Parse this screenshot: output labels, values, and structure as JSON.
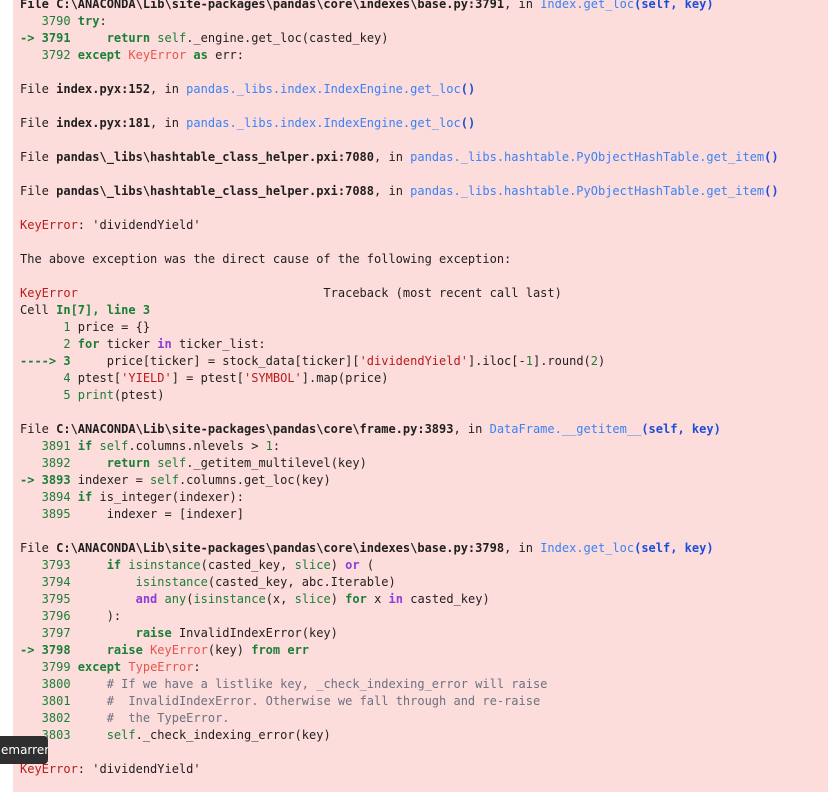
{
  "traceback_lines": [
    [
      [
        "b",
        "File C:\\ANACONDA\\Lib\\site-packages\\pandas\\core\\indexes\\base.py:3791"
      ],
      [
        "n",
        ", in "
      ],
      [
        "link",
        "Index.get_loc"
      ],
      [
        "cyanb",
        "(self, key)"
      ]
    ],
    [
      [
        "ln",
        "   3790 "
      ],
      [
        "kw",
        "try"
      ],
      [
        "n",
        ":"
      ]
    ],
    [
      [
        "lnb",
        "-> 3791 "
      ],
      [
        "n",
        "    "
      ],
      [
        "kw",
        "return"
      ],
      [
        "n",
        " "
      ],
      [
        "g",
        "self"
      ],
      [
        "n",
        "._engine.get_loc(casted_key)"
      ]
    ],
    [
      [
        "ln",
        "   3792 "
      ],
      [
        "kw",
        "except"
      ],
      [
        "n",
        " "
      ],
      [
        "r",
        "KeyError"
      ],
      [
        "n",
        " "
      ],
      [
        "kw",
        "as"
      ],
      [
        "n",
        " err:"
      ]
    ],
    [],
    [
      [
        "n",
        "File "
      ],
      [
        "b",
        "index.pyx:152"
      ],
      [
        "n",
        ", in "
      ],
      [
        "link",
        "pandas._libs.index.IndexEngine.get_loc"
      ],
      [
        "cyanb",
        "()"
      ]
    ],
    [],
    [
      [
        "n",
        "File "
      ],
      [
        "b",
        "index.pyx:181"
      ],
      [
        "n",
        ", in "
      ],
      [
        "link",
        "pandas._libs.index.IndexEngine.get_loc"
      ],
      [
        "cyanb",
        "()"
      ]
    ],
    [],
    [
      [
        "n",
        "File "
      ],
      [
        "b",
        "pandas\\_libs\\hashtable_class_helper.pxi:7080"
      ],
      [
        "n",
        ", in "
      ],
      [
        "link",
        "pandas._libs.hashtable.PyObjectHashTable.get_item"
      ],
      [
        "cyanb",
        "()"
      ]
    ],
    [],
    [
      [
        "n",
        "File "
      ],
      [
        "b",
        "pandas\\_libs\\hashtable_class_helper.pxi:7088"
      ],
      [
        "n",
        ", in "
      ],
      [
        "link",
        "pandas._libs.hashtable.PyObjectHashTable.get_item"
      ],
      [
        "cyanb",
        "()"
      ]
    ],
    [],
    [
      [
        "err",
        "KeyError"
      ],
      [
        "n",
        ": 'dividendYield'"
      ]
    ],
    [],
    [
      [
        "n",
        "The above exception was the direct cause of the following exception:"
      ]
    ],
    [],
    [
      [
        "err",
        "KeyError"
      ],
      [
        "n",
        "                                  Traceback (most recent call last)"
      ]
    ],
    [
      [
        "n",
        "Cell "
      ],
      [
        "gb",
        "In[7], line 3"
      ]
    ],
    [
      [
        "ln",
        "      1 "
      ],
      [
        "n",
        "price "
      ],
      [
        "n",
        "= {}"
      ]
    ],
    [
      [
        "ln",
        "      2 "
      ],
      [
        "kw",
        "for"
      ],
      [
        "n",
        " ticker "
      ],
      [
        "kwp",
        "in"
      ],
      [
        "n",
        " ticker_list:"
      ]
    ],
    [
      [
        "lnb",
        "----> 3 "
      ],
      [
        "n",
        "    price[ticker] "
      ],
      [
        "n",
        "= stock_data[ticker]["
      ],
      [
        "str",
        "'dividendYield'"
      ],
      [
        "n",
        "].iloc["
      ],
      [
        "n",
        "-"
      ],
      [
        "num",
        "1"
      ],
      [
        "n",
        "].round("
      ],
      [
        "num",
        "2"
      ],
      [
        "n",
        ")"
      ]
    ],
    [
      [
        "ln",
        "      4 "
      ],
      [
        "n",
        "ptest["
      ],
      [
        "str",
        "'YIELD'"
      ],
      [
        "n",
        "] = ptest["
      ],
      [
        "str",
        "'SYMBOL'"
      ],
      [
        "n",
        "].map(price)"
      ]
    ],
    [
      [
        "ln",
        "      5 "
      ],
      [
        "g",
        "print"
      ],
      [
        "n",
        "(ptest)"
      ]
    ],
    [],
    [
      [
        "n",
        "File "
      ],
      [
        "b",
        "C:\\ANACONDA\\Lib\\site-packages\\pandas\\core\\frame.py:3893"
      ],
      [
        "n",
        ", in "
      ],
      [
        "link",
        "DataFrame.__getitem__"
      ],
      [
        "cyanb",
        "(self, key)"
      ]
    ],
    [
      [
        "ln",
        "   3891 "
      ],
      [
        "kw",
        "if"
      ],
      [
        "n",
        " "
      ],
      [
        "g",
        "self"
      ],
      [
        "n",
        ".columns.nlevels > "
      ],
      [
        "num",
        "1"
      ],
      [
        "n",
        ":"
      ]
    ],
    [
      [
        "ln",
        "   3892 "
      ],
      [
        "n",
        "    "
      ],
      [
        "kw",
        "return"
      ],
      [
        "n",
        " "
      ],
      [
        "g",
        "self"
      ],
      [
        "n",
        "._getitem_multilevel(key)"
      ]
    ],
    [
      [
        "lnb",
        "-> 3893 "
      ],
      [
        "n",
        "indexer = "
      ],
      [
        "g",
        "self"
      ],
      [
        "n",
        ".columns.get_loc(key)"
      ]
    ],
    [
      [
        "ln",
        "   3894 "
      ],
      [
        "kw",
        "if"
      ],
      [
        "n",
        " is_integer(indexer):"
      ]
    ],
    [
      [
        "ln",
        "   3895 "
      ],
      [
        "n",
        "    indexer = [indexer]"
      ]
    ],
    [],
    [
      [
        "n",
        "File "
      ],
      [
        "b",
        "C:\\ANACONDA\\Lib\\site-packages\\pandas\\core\\indexes\\base.py:3798"
      ],
      [
        "n",
        ", in "
      ],
      [
        "link",
        "Index.get_loc"
      ],
      [
        "cyanb",
        "(self, key)"
      ]
    ],
    [
      [
        "ln",
        "   3793 "
      ],
      [
        "n",
        "    "
      ],
      [
        "kw",
        "if"
      ],
      [
        "n",
        " "
      ],
      [
        "g",
        "isinstance"
      ],
      [
        "n",
        "(casted_key, "
      ],
      [
        "g",
        "slice"
      ],
      [
        "n",
        ") "
      ],
      [
        "kwp",
        "or"
      ],
      [
        "n",
        " ("
      ]
    ],
    [
      [
        "ln",
        "   3794 "
      ],
      [
        "n",
        "        "
      ],
      [
        "g",
        "isinstance"
      ],
      [
        "n",
        "(casted_key, abc.Iterable)"
      ]
    ],
    [
      [
        "ln",
        "   3795 "
      ],
      [
        "n",
        "        "
      ],
      [
        "kwp",
        "and"
      ],
      [
        "n",
        " "
      ],
      [
        "g",
        "any"
      ],
      [
        "n",
        "("
      ],
      [
        "g",
        "isinstance"
      ],
      [
        "n",
        "(x, "
      ],
      [
        "g",
        "slice"
      ],
      [
        "n",
        ") "
      ],
      [
        "kw",
        "for"
      ],
      [
        "n",
        " x "
      ],
      [
        "kwp",
        "in"
      ],
      [
        "n",
        " casted_key)"
      ]
    ],
    [
      [
        "ln",
        "   3796 "
      ],
      [
        "n",
        "    ):"
      ]
    ],
    [
      [
        "ln",
        "   3797 "
      ],
      [
        "n",
        "        "
      ],
      [
        "kw",
        "raise"
      ],
      [
        "n",
        " InvalidIndexError(key)"
      ]
    ],
    [
      [
        "lnb",
        "-> 3798 "
      ],
      [
        "n",
        "    "
      ],
      [
        "kw",
        "raise"
      ],
      [
        "n",
        " "
      ],
      [
        "r",
        "KeyError"
      ],
      [
        "n",
        "(key) "
      ],
      [
        "kw",
        "from"
      ],
      [
        "n",
        " "
      ],
      [
        "kw",
        "err"
      ]
    ],
    [
      [
        "ln",
        "   3799 "
      ],
      [
        "kw",
        "except"
      ],
      [
        "n",
        " "
      ],
      [
        "r",
        "TypeError"
      ],
      [
        "n",
        ":"
      ]
    ],
    [
      [
        "ln",
        "   3800 "
      ],
      [
        "n",
        "    "
      ],
      [
        "cm",
        "# If we have a listlike key, _check_indexing_error will raise"
      ]
    ],
    [
      [
        "ln",
        "   3801 "
      ],
      [
        "n",
        "    "
      ],
      [
        "cm",
        "#  InvalidIndexError. Otherwise we fall through and re-raise"
      ]
    ],
    [
      [
        "ln",
        "   3802 "
      ],
      [
        "n",
        "    "
      ],
      [
        "cm",
        "#  the TypeError."
      ]
    ],
    [
      [
        "ln",
        "   3803 "
      ],
      [
        "n",
        "    "
      ],
      [
        "g",
        "self"
      ],
      [
        "n",
        "._check_indexing_error(key)"
      ]
    ],
    [],
    [
      [
        "err",
        "KeyError"
      ],
      [
        "n",
        ": 'dividendYield'"
      ]
    ]
  ],
  "toast": {
    "label": "emarrer"
  }
}
